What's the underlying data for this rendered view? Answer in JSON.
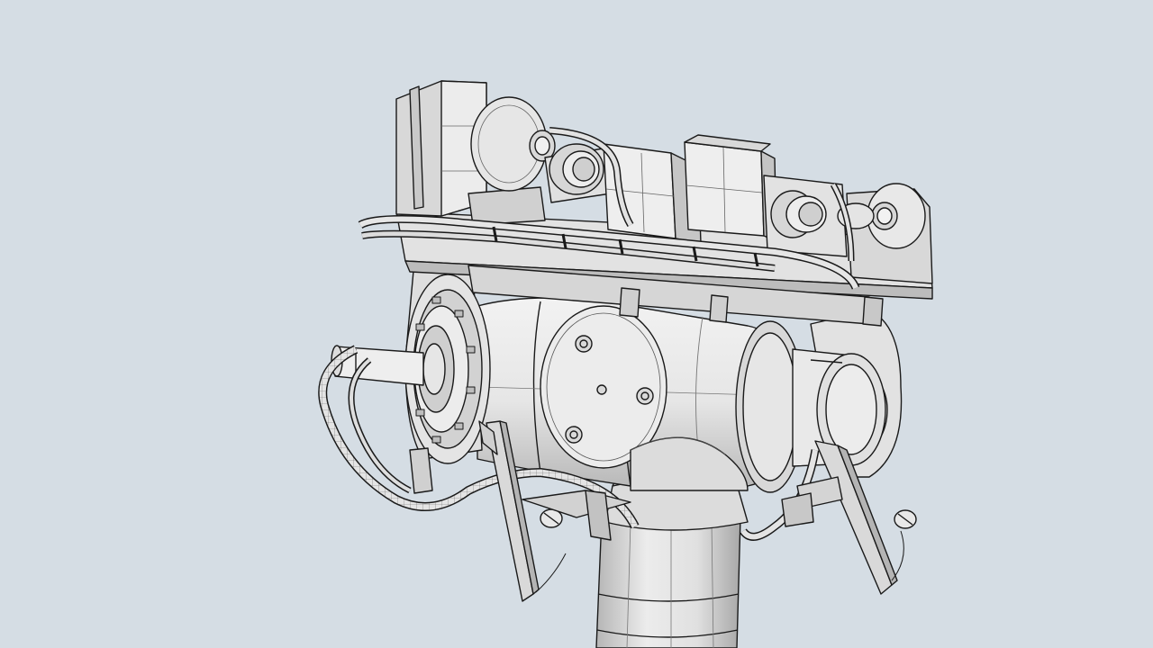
{
  "scene": {
    "colors": {
      "background": "#d5dde4",
      "fill": "#e8e8e8",
      "fill_light": "#f2f2f2",
      "fill_dark": "#c4c4c4",
      "fill_shadow": "#9e9e9e",
      "line": "#1a1a1a",
      "mesh": "#555555"
    }
  }
}
